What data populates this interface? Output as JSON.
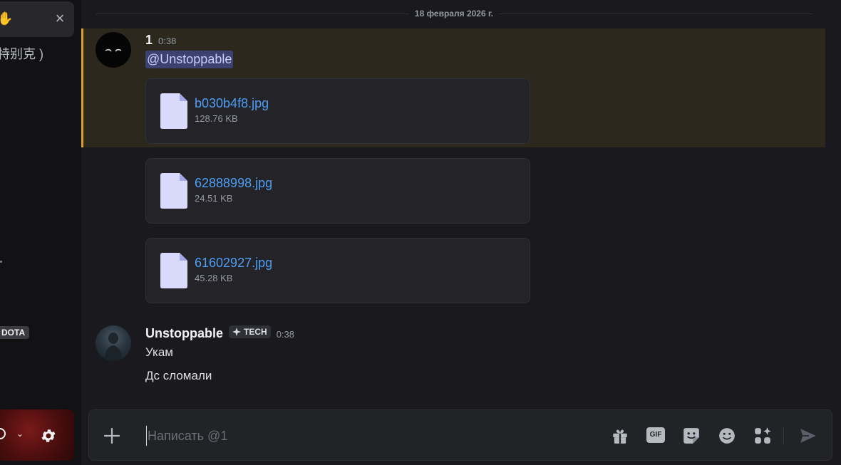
{
  "sidebar": {
    "dm_row_glyph": "✋",
    "truncated_name": "特别克 )",
    "server_tag": "DOTA"
  },
  "main": {
    "date_divider": "18 февраля 2026 г.",
    "messages": [
      {
        "author": "1",
        "time": "0:38",
        "mention": "@Unstoppable",
        "attachments": [
          {
            "name": "b030b4f8.jpg",
            "size": "128.76 KB"
          },
          {
            "name": "62888998.jpg",
            "size": "24.51 KB"
          },
          {
            "name": "61602927.jpg",
            "size": "45.28 KB"
          }
        ]
      },
      {
        "author": "Unstoppable",
        "badge": "TECH",
        "time": "0:38",
        "lines": [
          "Укам",
          "Дс сломали"
        ]
      }
    ]
  },
  "composer": {
    "placeholder": "Написать @1",
    "gif_label": "GIF"
  },
  "colors": {
    "mention_highlight": "#2c281d",
    "mention_bar": "#e0a023",
    "link": "#4f9ef5"
  }
}
